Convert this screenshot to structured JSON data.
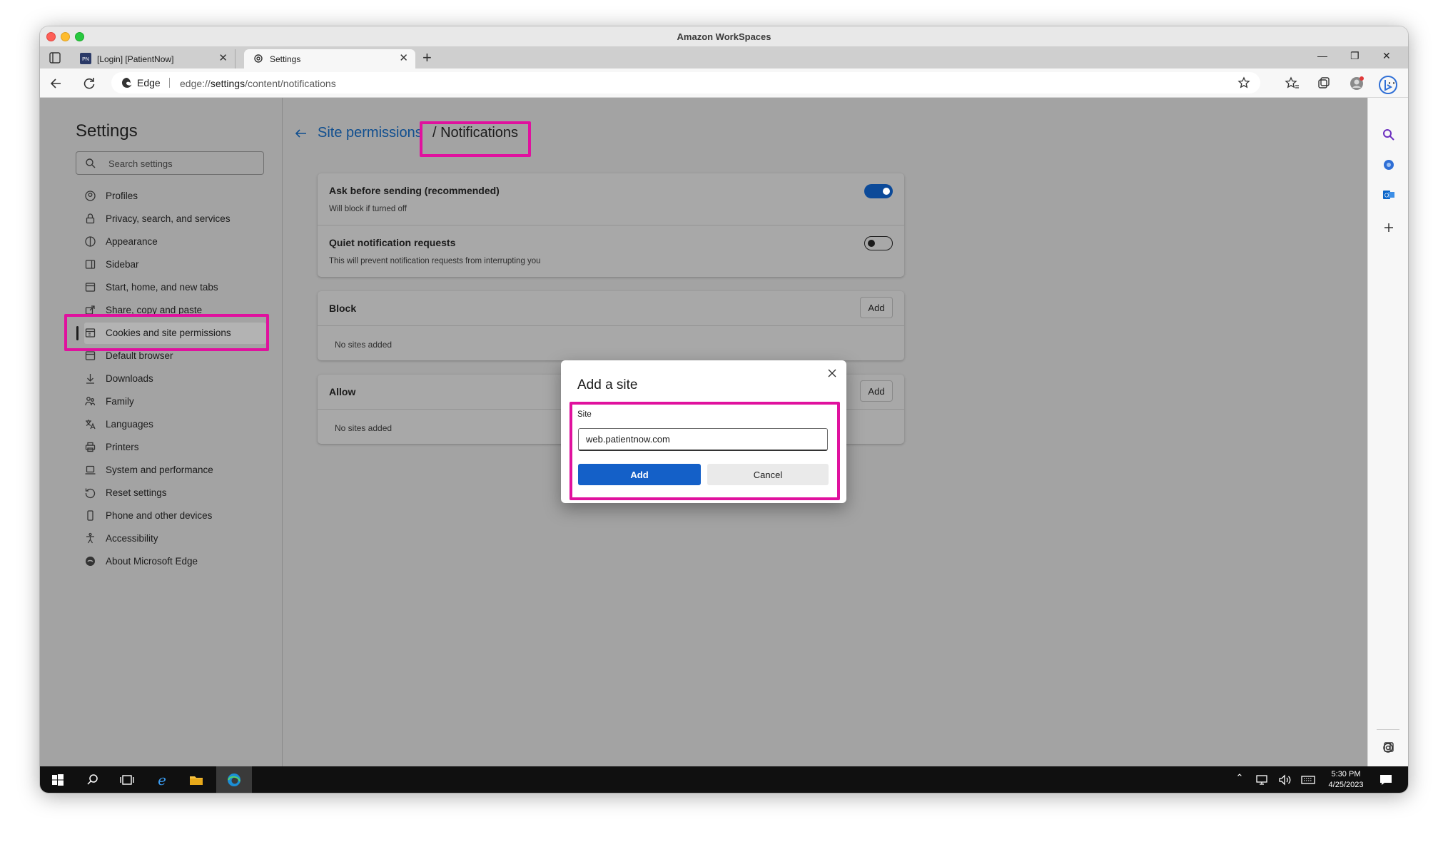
{
  "window": {
    "title": "Amazon WorkSpaces"
  },
  "tabs": [
    {
      "label": "[Login] [PatientNow]",
      "favicon": "patientnow-favicon"
    },
    {
      "label": "Settings",
      "favicon": "gear-icon"
    }
  ],
  "address_bar": {
    "badge": "Edge",
    "url_prefix": "edge://",
    "url_bold": "settings",
    "url_rest": "/content/notifications"
  },
  "settings_nav": {
    "title": "Settings",
    "search_placeholder": "Search settings",
    "items": [
      {
        "label": "Profiles",
        "icon": "profile-icon"
      },
      {
        "label": "Privacy, search, and services",
        "icon": "lock-icon"
      },
      {
        "label": "Appearance",
        "icon": "appearance-icon"
      },
      {
        "label": "Sidebar",
        "icon": "sidebar-icon"
      },
      {
        "label": "Start, home, and new tabs",
        "icon": "home-icon"
      },
      {
        "label": "Share, copy and paste",
        "icon": "share-icon"
      },
      {
        "label": "Cookies and site permissions",
        "icon": "cookies-icon",
        "active": true
      },
      {
        "label": "Default browser",
        "icon": "browser-icon"
      },
      {
        "label": "Downloads",
        "icon": "download-icon"
      },
      {
        "label": "Family",
        "icon": "family-icon"
      },
      {
        "label": "Languages",
        "icon": "languages-icon"
      },
      {
        "label": "Printers",
        "icon": "printer-icon"
      },
      {
        "label": "System and performance",
        "icon": "laptop-icon"
      },
      {
        "label": "Reset settings",
        "icon": "reset-icon"
      },
      {
        "label": "Phone and other devices",
        "icon": "phone-icon"
      },
      {
        "label": "Accessibility",
        "icon": "accessibility-icon"
      },
      {
        "label": "About Microsoft Edge",
        "icon": "edge-icon"
      }
    ]
  },
  "page": {
    "breadcrumb_parent": "Site permissions",
    "breadcrumb_current": "/ Notifications",
    "ask_before_sending": {
      "title": "Ask before sending (recommended)",
      "subtitle": "Will block if turned off",
      "enabled": true
    },
    "quiet_requests": {
      "title": "Quiet notification requests",
      "subtitle": "This will prevent notification requests from interrupting you",
      "enabled": false
    },
    "block": {
      "title": "Block",
      "add_label": "Add",
      "empty": "No sites added"
    },
    "allow": {
      "title": "Allow",
      "add_label": "Add",
      "empty": "No sites added"
    }
  },
  "dialog": {
    "title": "Add a site",
    "field_label": "Site",
    "field_value": "web.patientnow.com",
    "add_label": "Add",
    "cancel_label": "Cancel"
  },
  "taskbar": {
    "time": "5:30 PM",
    "date": "4/25/2023"
  },
  "colors": {
    "highlight": "#e0119e",
    "accent": "#1460c8",
    "link": "#0f4e8f"
  }
}
